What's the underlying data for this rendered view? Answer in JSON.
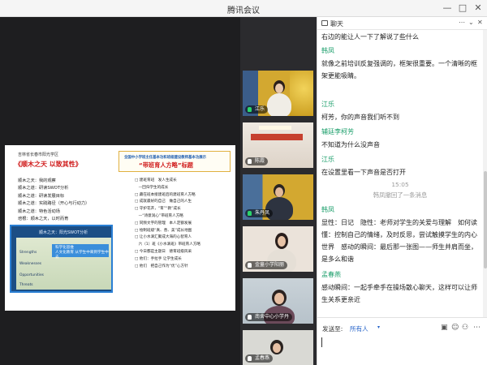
{
  "window": {
    "title": "腾讯会议",
    "minimize": "—",
    "maximize": "□",
    "close": "✕"
  },
  "chat": {
    "title": "聊天",
    "header_buttons": {
      "menu": "⋯",
      "collapse": "⌄",
      "close": "✕"
    },
    "messages": [
      {
        "sender": "",
        "text": "右边的能让人一下了解说了些什么"
      },
      {
        "sender": "韩凤",
        "text": "就像之前培训反复强调的，框架很重要。一个清晰的框架更能吸睛。"
      },
      {
        "sender": "江乐",
        "text": "柯芳，你的声音我们听不到"
      },
      {
        "sender": "辅廷李柯芳",
        "text": "不知道为什么没声音"
      },
      {
        "sender": "江乐",
        "text": "在设置里看一下声音是否打开"
      },
      {
        "sender": "韩凤",
        "text": "显性：日记　隐性：老师对学生的关爱与理解　如何读懂：控制自己的情绪，及时反思，尝试触摸学生的内心世界　感动的瞬间：最后那一张图——师生并肩而坐，是多么和谐"
      },
      {
        "sender": "孟春燕",
        "text": "感动瞬间：一起手牵手在操场散心聊天，这样可以让师生关系更亲近"
      }
    ],
    "system": {
      "time": "15:05",
      "notice": "韩凤撤回了一条消息"
    },
    "input": {
      "send_to_label": "发送至:",
      "send_to_value": "所有人",
      "caret": "▾",
      "tools": [
        "▣",
        "☺",
        "⚇",
        "⋯"
      ]
    }
  },
  "video_tiles": [
    {
      "name": "江乐",
      "mic_on": true,
      "bg": "#d2a928"
    },
    {
      "name": "陈霞",
      "mic_on": false,
      "bg": "#e9e3dc"
    },
    {
      "name": "朱丹凤",
      "mic_on": true,
      "bg": "#d2a928"
    },
    {
      "name": "金童小学阳丽",
      "mic_on": false,
      "bg": "#e7dfd6"
    },
    {
      "name": "南舍中心小学丹",
      "mic_on": false,
      "bg": "#cbd4da"
    },
    {
      "name": "孟春燕",
      "mic_on": false,
      "bg": "#dcdcd8"
    }
  ],
  "slide": {
    "left_top": "吉林省长春市阳光学区",
    "left_title": "《顺木之天 以致其性》",
    "left_list": [
      "顺木之天：我的观察",
      "顺木之道：研读SWOT分析",
      "顺木之道：研读发展目标",
      "顺木之道：实践路径（开心与行动力）",
      "顺木之道：特色活动场",
      "培根：顺木之天，以时而育"
    ],
    "image_title": "顺木之天：阳光SWOT分析",
    "image_band": [
      "科学化思维",
      "人文化教育 从学生中来到学生中去"
    ],
    "image_words": [
      "Strengths",
      "Weaknesses",
      "Opportunities",
      "Threats"
    ],
    "right_head_1": "全国中小学班主任基本功和班级建设教师基本功展示",
    "right_head_2": "“带班育人方略”标题",
    "right_list": [
      "□ 建班育班　发人生成长",
      "　—回归学生的成长",
      "□ 藏在班本接建班后的建班育人方略",
      "□ 成就最好的自己　做自己的人生",
      "□ 守护花开，“育”“教”成长",
      "　—“诗意润心”带班育人方略",
      "□ 同频文字的管理　本人定额发展",
      "□ 绘制班级“真、善、美”成长地图",
      "□ 让小水滴汇聚成大海的心智育人",
      "　六（1）班《小水滴班》带班育人方略",
      "□ 今日都是主题日　德育班级风采",
      "□ 他们：手拉手 让学生成长",
      "□ 他们　把自己作为“优”心方针"
    ]
  }
}
